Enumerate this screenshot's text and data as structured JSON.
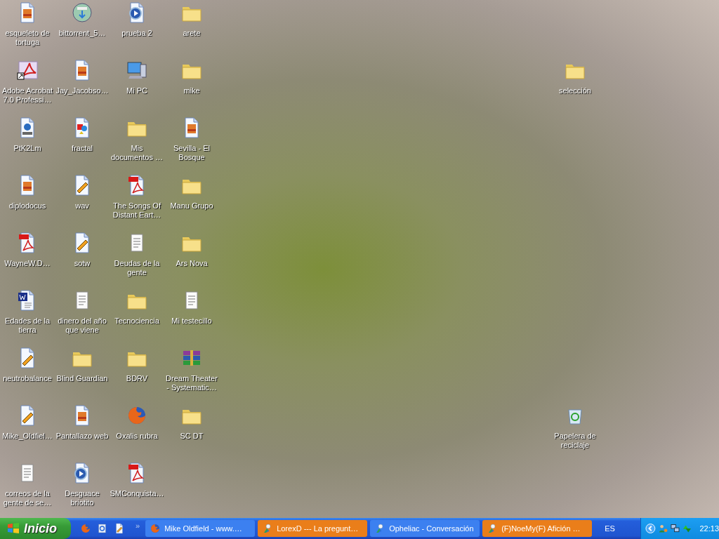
{
  "desktop": {
    "columns": [
      [
        {
          "label": "esqueleto de tortuga",
          "kind": "image"
        },
        {
          "label": "Adobe Acrobat 7.0 Professi…",
          "kind": "acrobat"
        },
        {
          "label": "PtK2Lm",
          "kind": "movie"
        },
        {
          "label": "diplodocus",
          "kind": "image"
        },
        {
          "label": "WayneW.D…",
          "kind": "pdf"
        },
        {
          "label": "Edades de la tierra",
          "kind": "word"
        },
        {
          "label": "neutrobalance",
          "kind": "audio"
        },
        {
          "label": "Mike_Oldfiel…",
          "kind": "audio"
        },
        {
          "label": "correos de la gente de se…",
          "kind": "text"
        }
      ],
      [
        {
          "label": "bittorrent_5…",
          "kind": "torrent"
        },
        {
          "label": "Jay_Jacobso…",
          "kind": "image"
        },
        {
          "label": "fractal",
          "kind": "fractal"
        },
        {
          "label": "wav",
          "kind": "audio"
        },
        {
          "label": "sotw",
          "kind": "audio"
        },
        {
          "label": "dinero del año que viene",
          "kind": "text"
        },
        {
          "label": "Blind Guardian",
          "kind": "folder"
        },
        {
          "label": "Pantallazo web",
          "kind": "image"
        },
        {
          "label": "Desguace briotito",
          "kind": "media"
        }
      ],
      [
        {
          "label": "prueba 2",
          "kind": "media"
        },
        {
          "label": "Mi PC",
          "kind": "computer"
        },
        {
          "label": "Mis documentos …",
          "kind": "folder"
        },
        {
          "label": "The Songs Of Distant Eart…",
          "kind": "pdf"
        },
        {
          "label": "Deudas de la gente",
          "kind": "text"
        },
        {
          "label": "Tecnociencia",
          "kind": "folder"
        },
        {
          "label": "BDRV",
          "kind": "folder"
        },
        {
          "label": "Oxalis rubra",
          "kind": "firefox"
        },
        {
          "label": "SMConquista…",
          "kind": "pdf"
        }
      ],
      [
        {
          "label": "arete",
          "kind": "folder"
        },
        {
          "label": "mike",
          "kind": "folder"
        },
        {
          "label": "Sevilla - El Bosque",
          "kind": "image"
        },
        {
          "label": "Manu Grupo",
          "kind": "folder"
        },
        {
          "label": "Ars Nova",
          "kind": "folder"
        },
        {
          "label": "Mi testecillo",
          "kind": "text"
        },
        {
          "label": "Dream Theater - Systematic…",
          "kind": "archive"
        },
        {
          "label": "SC DT",
          "kind": "folder"
        }
      ]
    ],
    "right_column": [
      {
        "label": "selección",
        "kind": "folder"
      },
      {
        "label": "Papelera de reciclaje",
        "kind": "recycle"
      }
    ]
  },
  "taskbar": {
    "start_label": "Inicio",
    "quick_launch": [
      {
        "kind": "firefox"
      },
      {
        "kind": "ie"
      },
      {
        "kind": "audio"
      }
    ],
    "overflow": "»",
    "tasks": [
      {
        "label": "Mike Oldfield - www.…",
        "kind": "firefox",
        "flashing": false
      },
      {
        "label": "LorexD --- La pregunt…",
        "kind": "messenger",
        "flashing": true
      },
      {
        "label": "Opheliac - Conversación",
        "kind": "messenger",
        "flashing": false
      },
      {
        "label": "(F)NoeMy(F) Afición …",
        "kind": "messenger",
        "flashing": true
      }
    ],
    "language": "ES",
    "clock": "22:13"
  }
}
